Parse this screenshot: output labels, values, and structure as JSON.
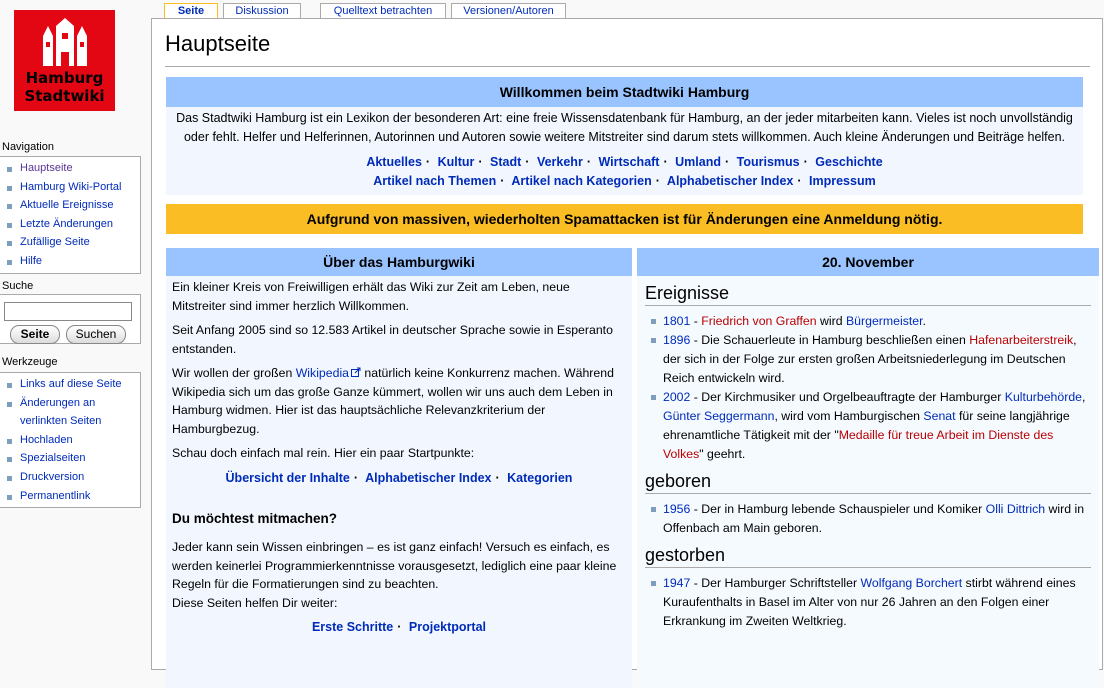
{
  "logo": {
    "line1": "Hamburg",
    "line2": "Stadtwiki"
  },
  "tabs": [
    "Seite",
    "Diskussion",
    "Quelltext betrachten",
    "Versionen/Autoren"
  ],
  "navigation": {
    "heading": "Navigation",
    "items": [
      "Hauptseite",
      "Hamburg Wiki-Portal",
      "Aktuelle Ereignisse",
      "Letzte Änderungen",
      "Zufällige Seite",
      "Hilfe"
    ]
  },
  "search": {
    "heading": "Suche",
    "input_value": "",
    "go_label": "Seite",
    "search_label": "Suchen"
  },
  "tools": {
    "heading": "Werkzeuge",
    "items": [
      "Links auf diese Seite",
      "Änderungen an verlinkten Seiten",
      "Hochladen",
      "Spezialseiten",
      "Druckversion",
      "Permanentlink"
    ]
  },
  "page_title": "Hauptseite",
  "welcome": {
    "heading": "Willkommen beim Stadtwiki Hamburg",
    "intro": "Das Stadtwiki Hamburg ist ein Lexikon der besonderen Art: eine freie Wissensdatenbank für Hamburg, an der jeder mitarbeiten kann. Vieles ist noch unvollständig oder fehlt. Helfer und Helferinnen, Autorinnen und Autoren sowie weitere Mitstreiter sind darum stets willkommen. Auch kleine Änderungen und Beiträge helfen.",
    "links_row1": [
      "Aktuelles",
      "Kultur",
      "Stadt",
      "Verkehr",
      "Wirtschaft",
      "Umland",
      "Tourismus",
      "Geschichte"
    ],
    "links_row2": [
      "Artikel nach Themen",
      "Artikel nach Kategorien",
      "Alphabetischer Index",
      "Impressum"
    ]
  },
  "spam_notice": "Aufgrund von massiven, wiederholten Spamattacken ist für Änderungen eine Anmeldung nötig.",
  "about": {
    "heading": "Über das Hamburgwiki",
    "p1": "Ein kleiner Kreis von Freiwilligen erhält das Wiki zur Zeit am Leben, neue Mitstreiter sind immer herzlich Willkommen.",
    "p2": "Seit Anfang 2005 sind so 12.583 Artikel in deutscher Sprache sowie in Esperanto entstanden.",
    "p3_before": "Wir wollen der großen ",
    "p3_link": "Wikipedia",
    "p3_after": " natürlich keine Konkurrenz machen. Während Wikipedia sich um das große Ganze kümmert, wollen wir uns auch dem Leben in Hamburg widmen. Hier ist das hauptsächliche Relevanzkriterium der Hamburgbezug.",
    "p4": "Schau doch einfach mal rein. Hier ein paar Startpunkte:",
    "start_links": [
      "Übersicht der Inhalte",
      "Alphabetischer Index",
      "Kategorien"
    ],
    "join_heading": "Du möchtest mitmachen?",
    "join_text": "Jeder kann sein Wissen einbringen – es ist ganz einfach! Versuch es einfach, es werden keinerlei Programmierkenntnisse vorausgesetzt, lediglich eine paar kleine Regeln für die Formatierungen sind zu beachten.",
    "join_text2": "Diese Seiten helfen Dir weiter:",
    "help_links": [
      "Erste Schritte",
      "Projektportal"
    ]
  },
  "date_box": {
    "heading": "20. November",
    "events_heading": "Ereignisse",
    "events": [
      {
        "year": "1801",
        "parts": [
          [
            "link-red",
            "Friedrich von Graffen"
          ],
          [
            "text",
            " wird "
          ],
          [
            "link",
            "Bürgermeister"
          ],
          [
            "text",
            "."
          ]
        ]
      },
      {
        "year": "1896",
        "parts": [
          [
            "text",
            " - Die Schauerleute in Hamburg beschließen einen "
          ],
          [
            "link-red",
            "Hafenarbeiterstreik"
          ],
          [
            "text",
            ", der sich in der Folge zur ersten großen Arbeitsniederlegung im Deutschen Reich entwickeln wird."
          ]
        ]
      },
      {
        "year": "2002",
        "parts": [
          [
            "text",
            " - Der Kirchmusiker und Orgelbeauftragte der Hamburger "
          ],
          [
            "link",
            "Kulturbehörde"
          ],
          [
            "text",
            ", "
          ],
          [
            "link",
            "Günter Seggermann"
          ],
          [
            "text",
            ", wird vom Hamburgischen "
          ],
          [
            "link",
            "Senat"
          ],
          [
            "text",
            " für seine langjährige ehrenamtliche Tätigkeit mit der \""
          ],
          [
            "link-red",
            "Medaille für treue Arbeit im Dienste des Volkes"
          ],
          [
            "text",
            "\" geehrt."
          ]
        ]
      }
    ],
    "born_heading": "geboren",
    "born": [
      {
        "year": "1956",
        "parts": [
          [
            "text",
            " - Der in Hamburg lebende Schauspieler und Komiker "
          ],
          [
            "link",
            "Olli Dittrich"
          ],
          [
            "text",
            " wird in Offenbach am Main geboren."
          ]
        ]
      }
    ],
    "died_heading": "gestorben",
    "died": [
      {
        "year": "1947",
        "parts": [
          [
            "text",
            " - Der Hamburger Schriftsteller "
          ],
          [
            "link",
            "Wolfgang Borchert"
          ],
          [
            "text",
            " stirbt während eines Kuraufenthalts in Basel im Alter von nur 26 Jahren an den Folgen einer Erkrankung im Zweiten Weltkrieg."
          ]
        ]
      }
    ]
  }
}
